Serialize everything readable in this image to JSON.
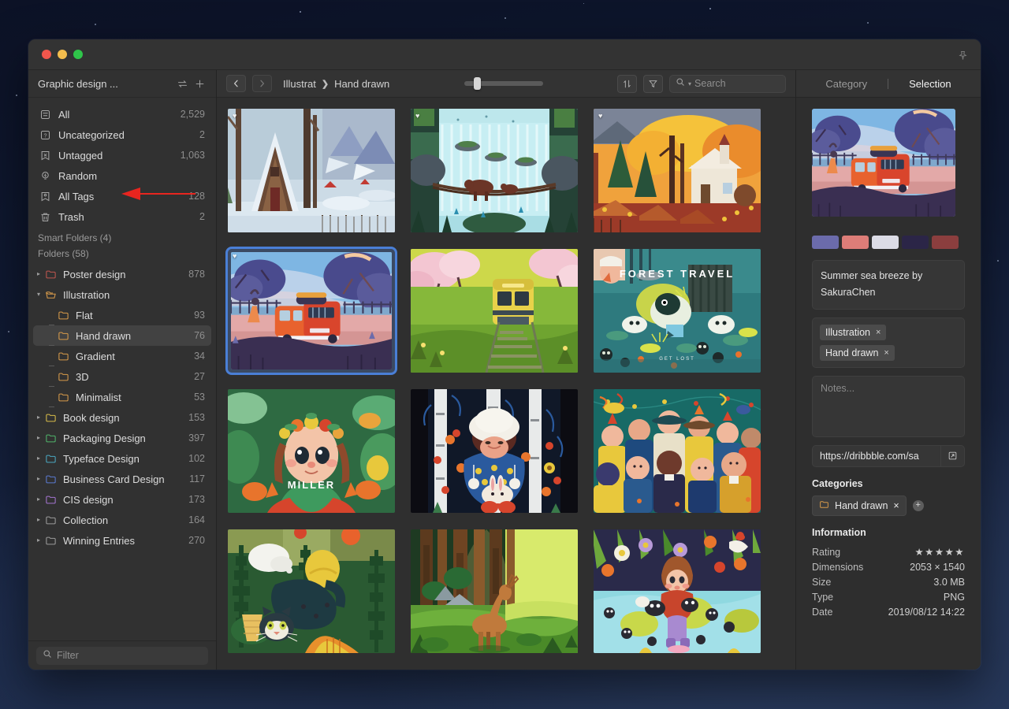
{
  "window": {
    "titlebar": {
      "pin_icon": "pin-icon"
    }
  },
  "sidebar": {
    "library_title": "Graphic design ...",
    "sort_icon": "sort-arrows-icon",
    "add_icon": "plus-icon",
    "nav": [
      {
        "label": "All",
        "count": "2,529",
        "icon": "all-items-icon"
      },
      {
        "label": "Uncategorized",
        "count": "2",
        "icon": "uncategorized-icon"
      },
      {
        "label": "Untagged",
        "count": "1,063",
        "icon": "untagged-icon"
      },
      {
        "label": "Random",
        "count": "",
        "icon": "random-bulb-icon"
      },
      {
        "label": "All Tags",
        "count": "128",
        "icon": "all-tags-icon"
      },
      {
        "label": "Trash",
        "count": "2",
        "icon": "trash-icon"
      }
    ],
    "smart_folders_label": "Smart Folders (4)",
    "folders_label": "Folders (58)",
    "folders": [
      {
        "label": "Poster design",
        "count": "878",
        "color": "#c0564f",
        "expanded": false,
        "depth": 0
      },
      {
        "label": "Illustration",
        "count": "",
        "color": "#d79a4a",
        "expanded": true,
        "depth": 0
      },
      {
        "label": "Flat",
        "count": "93",
        "color": "#d79a4a",
        "depth": 1
      },
      {
        "label": "Hand drawn",
        "count": "76",
        "color": "#d79a4a",
        "depth": 1,
        "selected": true
      },
      {
        "label": "Gradient",
        "count": "34",
        "color": "#d79a4a",
        "depth": 1
      },
      {
        "label": "3D",
        "count": "27",
        "color": "#d79a4a",
        "depth": 1
      },
      {
        "label": "Minimalist",
        "count": "53",
        "color": "#d79a4a",
        "depth": 1,
        "last": true
      },
      {
        "label": "Book design",
        "count": "153",
        "color": "#d7bb4a",
        "expanded": false,
        "depth": 0
      },
      {
        "label": "Packaging Design",
        "count": "397",
        "color": "#4fb36a",
        "expanded": false,
        "depth": 0
      },
      {
        "label": "Typeface Design",
        "count": "102",
        "color": "#4aa6c0",
        "expanded": false,
        "depth": 0
      },
      {
        "label": "Business Card Design",
        "count": "117",
        "color": "#5a7ad0",
        "expanded": false,
        "depth": 0
      },
      {
        "label": "CIS design",
        "count": "173",
        "color": "#a濃",
        "expanded": false,
        "depth": 0
      },
      {
        "label": "Collection",
        "count": "164",
        "color": "#9a9a9a",
        "expanded": false,
        "depth": 0
      },
      {
        "label": "Winning Entries",
        "count": "270",
        "color": "#9a9a9a",
        "expanded": false,
        "depth": 0
      }
    ],
    "filter_placeholder": "Filter",
    "filter_icon": "search-icon"
  },
  "toolbar": {
    "back_icon": "chevron-left-icon",
    "forward_icon": "chevron-right-icon",
    "breadcrumb": [
      "Illustrat",
      "Hand drawn"
    ],
    "breadcrumb_sep": "❯",
    "zoom_value": 12,
    "sort_icon": "sort-updown-icon",
    "filter_icon": "funnel-icon",
    "search_icon": "search-icon",
    "search_placeholder": "Search",
    "search_value": ""
  },
  "grid": {
    "items": [
      {
        "name": "snowy-cabin-forest",
        "heart": "♥",
        "selected": false,
        "caption": "",
        "subcaption": ""
      },
      {
        "name": "waterfall-bears-bridge",
        "heart": "♥",
        "selected": false,
        "caption": "",
        "subcaption": ""
      },
      {
        "name": "autumn-church-house",
        "heart": "♥",
        "selected": false,
        "caption": "",
        "subcaption": ""
      },
      {
        "name": "summer-sea-breeze-van",
        "heart": "♥",
        "selected": true,
        "caption": "",
        "subcaption": ""
      },
      {
        "name": "cherry-blossom-train",
        "heart": "",
        "selected": false,
        "caption": "",
        "subcaption": ""
      },
      {
        "name": "forest-travel-poster",
        "heart": "",
        "selected": false,
        "caption": "FOREST TRAVEL",
        "subcaption": "GET LOST"
      },
      {
        "name": "flower-crown-girl-miller",
        "heart": "",
        "selected": false,
        "caption": "MILLER",
        "subcaption": ""
      },
      {
        "name": "winter-birch-bunny-girl",
        "heart": "",
        "selected": false,
        "caption": "",
        "subcaption": ""
      },
      {
        "name": "party-crowd-people",
        "heart": "",
        "selected": false,
        "caption": "",
        "subcaption": ""
      },
      {
        "name": "cat-plants-pattern",
        "heart": "",
        "selected": false,
        "caption": "",
        "subcaption": ""
      },
      {
        "name": "deer-sunlit-forest",
        "heart": "",
        "selected": false,
        "caption": "",
        "subcaption": ""
      },
      {
        "name": "girl-flowers-soot-sprites",
        "heart": "",
        "selected": false,
        "caption": "",
        "subcaption": ""
      }
    ]
  },
  "inspector": {
    "tabs": [
      {
        "label": "Category",
        "active": false
      },
      {
        "label": "Selection",
        "active": true
      }
    ],
    "preview_name": "summer-sea-breeze-van-preview",
    "palette": [
      "#6b6bab",
      "#dd7d78",
      "#dcdce6",
      "#2b2547",
      "#8b3e3e"
    ],
    "title": "Summer sea breeze by SakuraChen",
    "tags": [
      {
        "label": "Illustration",
        "remove": "×"
      },
      {
        "label": "Hand drawn",
        "remove": "×"
      }
    ],
    "notes_placeholder": "Notes...",
    "url": "https://dribbble.com/sa",
    "url_open_icon": "external-link-icon",
    "categories_heading": "Categories",
    "category_chip": {
      "label": "Hand drawn",
      "remove": "×",
      "icon": "folder-icon"
    },
    "add_category_icon": "plus-circle-icon",
    "information_heading": "Information",
    "information": [
      {
        "key": "Rating",
        "value": "★★★★★",
        "is_stars": true
      },
      {
        "key": "Dimensions",
        "value": "2053 × 1540"
      },
      {
        "key": "Size",
        "value": "3.0 MB"
      },
      {
        "key": "Type",
        "value": "PNG"
      },
      {
        "key": "Date",
        "value": "2019/08/12 14:22"
      }
    ]
  },
  "annotation": {
    "arrow_color": "#e8251f",
    "points_at": "Random"
  },
  "colors": {
    "accent_selection": "#4a7fd6",
    "window_bg": "#2b2b2b",
    "sidebar_bg": "#313131",
    "inspector_bg": "#2e2e2e"
  }
}
